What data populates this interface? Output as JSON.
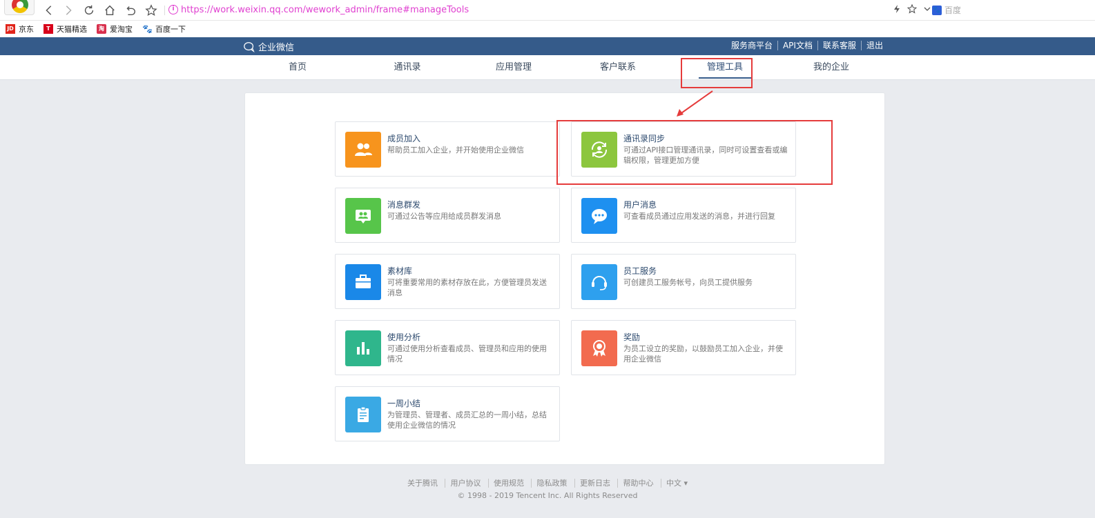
{
  "browser": {
    "url": "https://work.weixin.qq.com/wework_admin/frame#manageTools",
    "search_engine": "百度",
    "bookmarks": [
      {
        "icon": "JD",
        "label": "京东"
      },
      {
        "icon": "T",
        "label": "天猫精选"
      },
      {
        "icon": "淘",
        "label": "爱淘宝"
      },
      {
        "icon": "🐾",
        "label": "百度一下"
      }
    ]
  },
  "topbar": {
    "brand": "企业微信",
    "links": [
      "服务商平台",
      "API文档",
      "联系客服",
      "退出"
    ]
  },
  "nav": {
    "tabs": [
      "首页",
      "通讯录",
      "应用管理",
      "客户联系",
      "管理工具",
      "我的企业"
    ],
    "active": "管理工具"
  },
  "tools": [
    {
      "title": "成员加入",
      "desc": "帮助员工加入企业，并开始使用企业微信",
      "color": "#f7941d",
      "icon": "users-icon"
    },
    {
      "title": "通讯录同步",
      "desc": "可通过API接口管理通讯录，同时可设置查看或编辑权限，管理更加方便",
      "color": "#8cc63e",
      "icon": "sync-icon"
    },
    {
      "title": "消息群发",
      "desc": "可通过公告等应用给成员群发消息",
      "color": "#57c54a",
      "icon": "broadcast-icon"
    },
    {
      "title": "用户消息",
      "desc": "可查看成员通过应用发送的消息，并进行回复",
      "color": "#1e90f0",
      "icon": "chat-icon"
    },
    {
      "title": "素材库",
      "desc": "可将重要常用的素材存放在此，方便管理员发送消息",
      "color": "#1a88e8",
      "icon": "briefcase-icon"
    },
    {
      "title": "员工服务",
      "desc": "可创建员工服务帐号，向员工提供服务",
      "color": "#2ea0ee",
      "icon": "headset-icon"
    },
    {
      "title": "使用分析",
      "desc": "可通过使用分析查看成员、管理员和应用的使用情况",
      "color": "#2fb68c",
      "icon": "bar-chart-icon"
    },
    {
      "title": "奖励",
      "desc": "为员工设立的奖励，以鼓励员工加入企业，并使用企业微信",
      "color": "#f26b4f",
      "icon": "award-icon"
    },
    {
      "title": "一周小结",
      "desc": "为管理员、管理者、成员汇总的一周小结，总结使用企业微信的情况",
      "color": "#3aa9e4",
      "icon": "clipboard-icon"
    }
  ],
  "footer": {
    "links": [
      "关于腾讯",
      "用户协议",
      "使用规范",
      "隐私政策",
      "更新日志",
      "帮助中心",
      "中文 ▾"
    ],
    "copyright": "© 1998 - 2019 Tencent Inc. All Rights Reserved"
  },
  "colors": {
    "topbar": "#355b8a",
    "annotation": "#e53b3b",
    "url": "#e040d0"
  }
}
